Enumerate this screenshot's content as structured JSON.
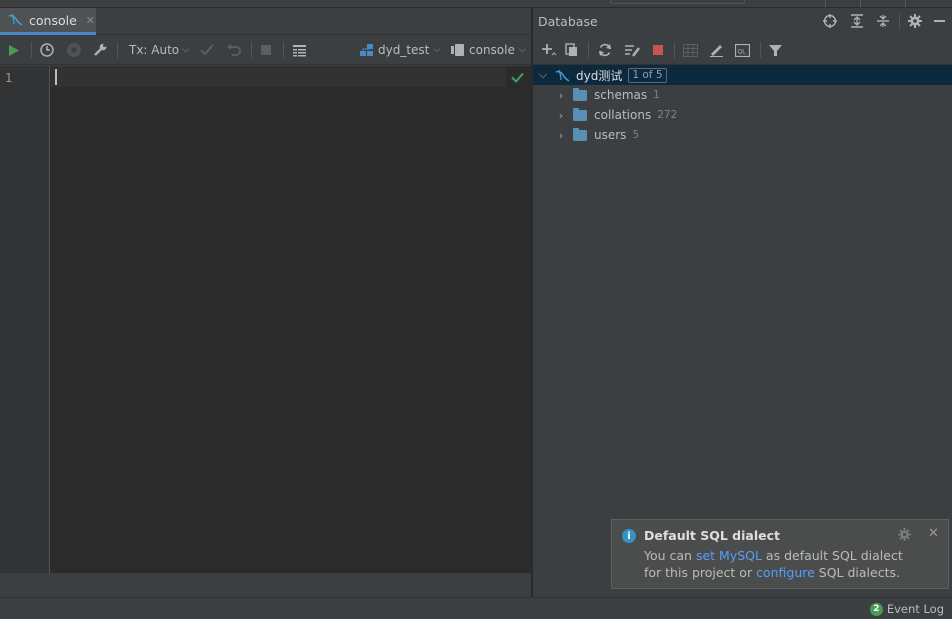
{
  "editor": {
    "tab": {
      "label": "console",
      "icon": "mysql-console-icon"
    },
    "toolbar": {
      "tx_label": "Tx: Auto",
      "datasource_label": "dyd_test",
      "session_label": "console"
    },
    "line_numbers": [
      "1"
    ]
  },
  "database_panel": {
    "title": "Database",
    "tree": {
      "root": {
        "label": "dyd测试",
        "badge": "1 of 5",
        "expanded": true
      },
      "children": [
        {
          "label": "schemas",
          "count": "1"
        },
        {
          "label": "collations",
          "count": "272"
        },
        {
          "label": "users",
          "count": "5"
        }
      ]
    }
  },
  "notification": {
    "title": "Default SQL dialect",
    "line1_prefix": "You can ",
    "line1_link": "set MySQL",
    "line1_suffix": " as default SQL dialect",
    "line2_prefix": "for this project or ",
    "line2_link": "configure",
    "line2_suffix": " SQL dialects."
  },
  "statusbar": {
    "event_log_count": "2",
    "event_log_label": "Event Log"
  },
  "colors": {
    "accent": "#4a88c7",
    "run_green": "#499c54",
    "stop_red": "#c75450",
    "link": "#589df6",
    "selection": "#0d293e"
  }
}
